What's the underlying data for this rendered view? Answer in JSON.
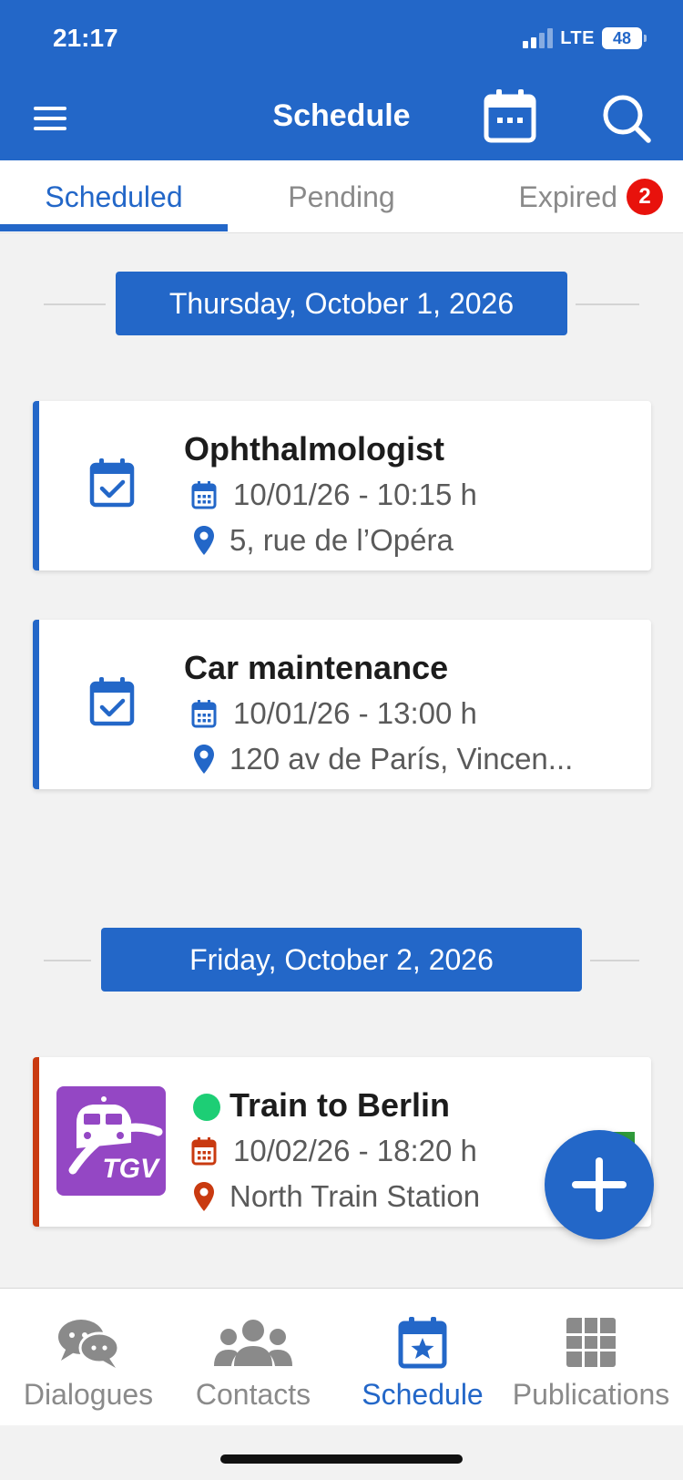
{
  "status_bar": {
    "time": "21:17",
    "network": "LTE",
    "battery": "48"
  },
  "header": {
    "title": "Schedule"
  },
  "tabs": [
    {
      "label": "Scheduled",
      "active": true
    },
    {
      "label": "Pending",
      "active": false
    },
    {
      "label": "Expired",
      "active": false,
      "badge": "2"
    }
  ],
  "groups": [
    {
      "date": "Thursday, October 1, 2026",
      "events": [
        {
          "title": "Ophthalmologist",
          "datetime": "10/01/26 - 10:15 h",
          "location": "5, rue de l’Opéra",
          "icon": "calendar-check-icon",
          "accent_color": "#2367c8"
        },
        {
          "title": "Car maintenance",
          "datetime": "10/01/26 - 13:00 h",
          "location": "120 av de París, Vincen...",
          "icon": "calendar-check-icon",
          "accent_color": "#2367c8"
        }
      ]
    },
    {
      "date": "Friday, October 2, 2026",
      "events": [
        {
          "title": "Train to Berlin",
          "datetime": "10/02/26 - 18:20 h",
          "location": "North Train Station",
          "icon": "tgv-logo",
          "logo_text": "TGV",
          "accent_color": "#c93a10",
          "status_color": "#1dce75"
        }
      ]
    }
  ],
  "bottom_nav": [
    {
      "label": "Dialogues",
      "icon": "chat-bubbles-icon",
      "active": false
    },
    {
      "label": "Contacts",
      "icon": "people-icon",
      "active": false
    },
    {
      "label": "Schedule",
      "icon": "calendar-star-icon",
      "active": true
    },
    {
      "label": "Publications",
      "icon": "grid-icon",
      "active": false
    }
  ],
  "colors": {
    "primary": "#2367c8",
    "badge": "#e8120c",
    "train_accent": "#c93a10",
    "tgv_purple": "#9447c4"
  }
}
